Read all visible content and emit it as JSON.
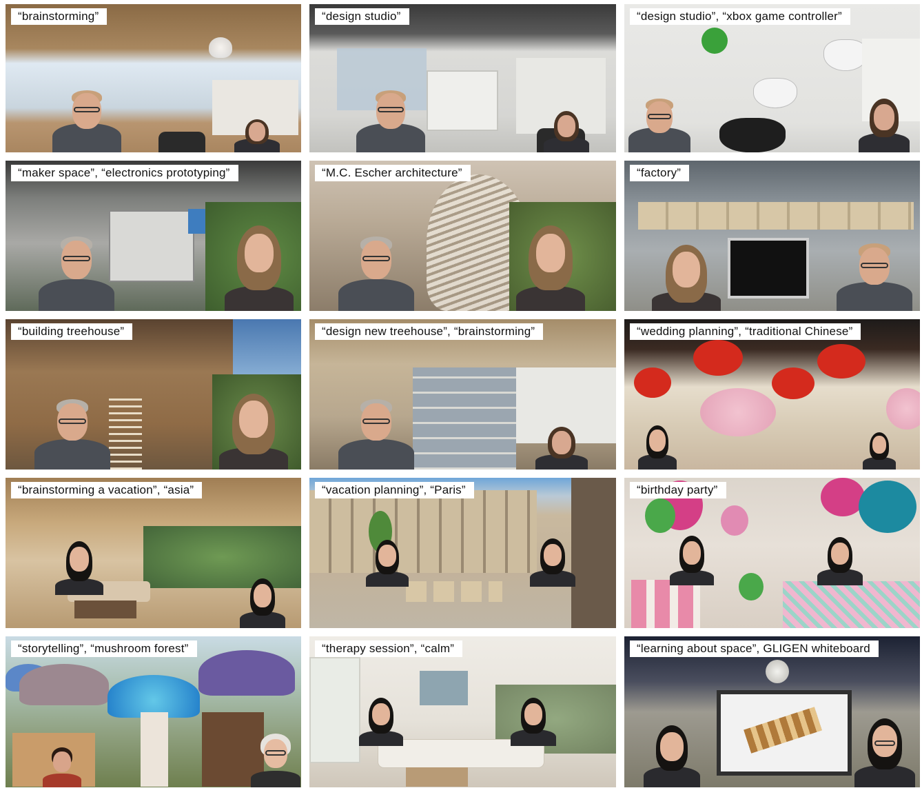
{
  "tiles": [
    {
      "caption": "“brainstorming”",
      "wall": "#c9b08a",
      "ceiling": "#8a6a45",
      "floor": "#b89570",
      "accent": "#dfe9f2",
      "people": [
        "man",
        "woman-dark"
      ]
    },
    {
      "caption": "“design studio”",
      "wall": "#d9d9d6",
      "ceiling": "#4a4a4a",
      "floor": "#bfbfbb",
      "accent": "#b8c8d6",
      "people": [
        "man",
        "woman-dark"
      ]
    },
    {
      "caption": "“design studio”, “xbox game controller”",
      "wall": "#e4e4e2",
      "ceiling": "#cfcfcf",
      "floor": "#d8d8d6",
      "accent": "#3aa13a",
      "people": [
        "man",
        "woman-dark"
      ]
    },
    {
      "caption": "“maker space”, “electronics prototyping”",
      "wall": "#a9a9a6",
      "ceiling": "#3a3a3a",
      "floor": "#5f6a5a",
      "accent": "#4a7a3a",
      "people": [
        "man",
        "woman-light"
      ]
    },
    {
      "caption": "“M.C. Escher architecture”",
      "wall": "#b9aa96",
      "ceiling": "#cfc3b4",
      "floor": "#8c7d6a",
      "accent": "#5f7f40",
      "people": [
        "man",
        "woman-light"
      ]
    },
    {
      "caption": "“factory”",
      "wall": "#9fa6ac",
      "ceiling": "#5e666d",
      "floor": "#8f8f88",
      "accent": "#d7c7a7",
      "people": [
        "woman-light",
        "man"
      ]
    },
    {
      "caption": "“building treehouse”",
      "wall": "#8f6b46",
      "ceiling": "#9a7853",
      "floor": "#6d573f",
      "accent": "#6a8a4a",
      "people": [
        "man",
        "woman-light"
      ]
    },
    {
      "caption": "“design new treehouse”, “brainstorming”",
      "wall": "#b7a78e",
      "ceiling": "#a58d6a",
      "floor": "#8a7b66",
      "accent": "#d2d6da",
      "people": [
        "man",
        "woman-dark"
      ]
    },
    {
      "caption": "“wedding planning”, “traditional Chinese”",
      "wall": "#e6ddcc",
      "ceiling": "#1e1b1a",
      "floor": "#c9b7a0",
      "accent": "#d42a1d",
      "people": [
        "asian-woman",
        "asian-woman"
      ]
    },
    {
      "caption": "“brainstorming a vacation”, “asia”",
      "wall": "#c8a97c",
      "ceiling": "#a07e54",
      "floor": "#b79a72",
      "accent": "#5e8a4a",
      "people": [
        "asian-woman",
        "asian-woman"
      ]
    },
    {
      "caption": "“vacation planning”, “Paris”",
      "wall": "#c9b99f",
      "ceiling": "#6fa6d8",
      "floor": "#bfb6a6",
      "accent": "#7a9a5a",
      "people": [
        "asian-woman",
        "asian-woman"
      ]
    },
    {
      "caption": "“birthday party”",
      "wall": "#e7e0d8",
      "ceiling": "#dcd5cc",
      "floor": "#d9cfc4",
      "accent": "#d43f86",
      "people": [
        "asian-woman",
        "asian-woman"
      ]
    },
    {
      "caption": "“storytelling”, “mushroom forest”",
      "wall": "#8fa07f",
      "ceiling": "#c9dbe4",
      "floor": "#6e7f4e",
      "accent": "#3b8fd8",
      "people": [
        "child",
        "old-woman"
      ]
    },
    {
      "caption": "“therapy session”, “calm”",
      "wall": "#e6e2da",
      "ceiling": "#efece6",
      "floor": "#cfc7ba",
      "accent": "#7e9a6a",
      "people": [
        "asian-woman",
        "asian-woman"
      ]
    },
    {
      "caption": "“learning about space”, GLIGEN whiteboard",
      "wall": "#9d9a90",
      "ceiling": "#1c2233",
      "floor": "#7d7a6a",
      "accent": "#f2f2f2",
      "people": [
        "asian-woman",
        "asian-woman"
      ]
    }
  ]
}
